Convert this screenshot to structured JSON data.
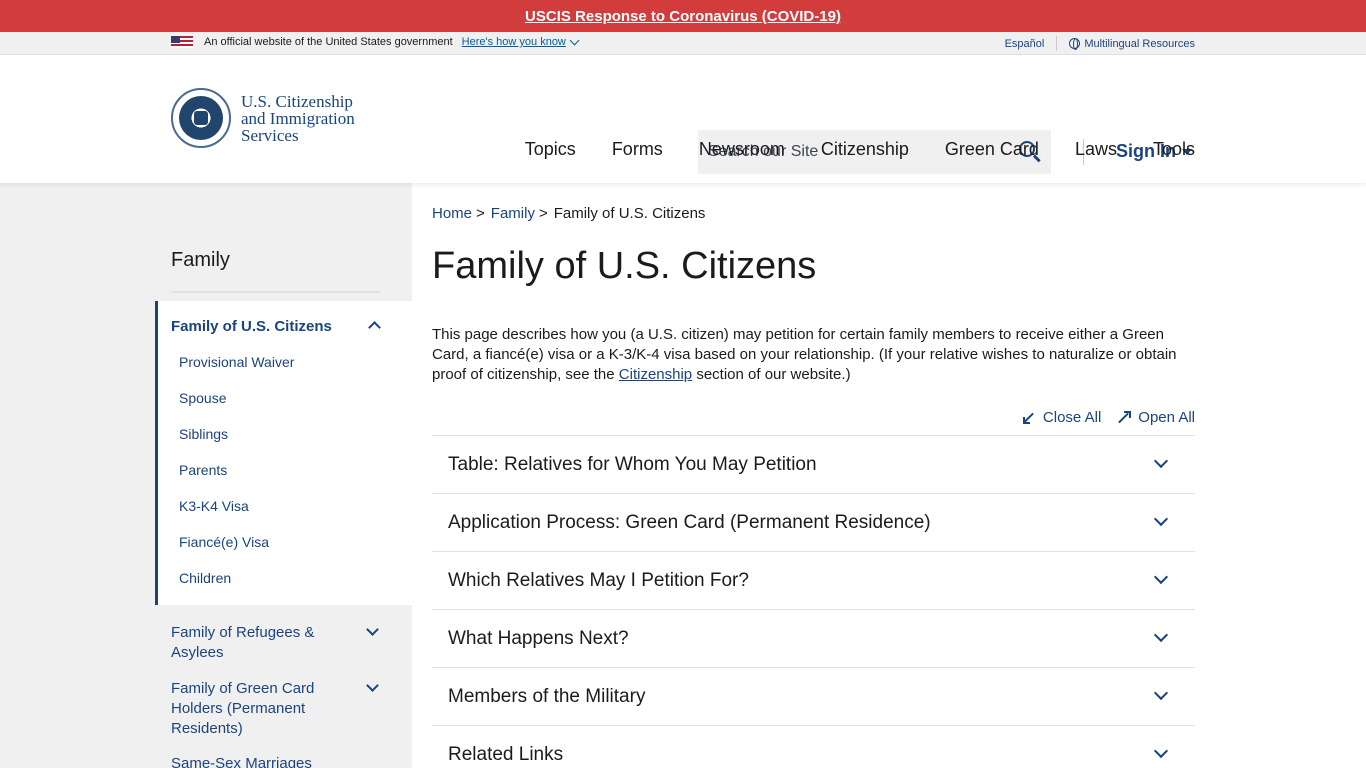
{
  "alert": {
    "text": "USCIS Response to Coronavirus (COVID-19)"
  },
  "gov_banner": {
    "official_text": "An official website of the United States government",
    "how_link": "Here's how you know",
    "espanol": "Español",
    "multilingual": "Multilingual Resources"
  },
  "header": {
    "logo_line1": "U.S. Citizenship",
    "logo_line2": "and Immigration",
    "logo_line3": "Services",
    "search_placeholder": "Search our Site",
    "sign_in": "Sign In",
    "nav": [
      "Topics",
      "Forms",
      "Newsroom",
      "Citizenship",
      "Green Card",
      "Laws",
      "Tools"
    ]
  },
  "sidebar": {
    "title": "Family",
    "active_section": "Family of U.S. Citizens",
    "sub_items": [
      "Provisional Waiver",
      "Spouse",
      "Siblings",
      "Parents",
      "K3-K4 Visa",
      "Fiancé(e) Visa",
      "Children"
    ],
    "other_items": [
      "Family of Refugees & Asylees",
      "Family of Green Card Holders (Permanent Residents)",
      "Same-Sex Marriages"
    ]
  },
  "breadcrumb": {
    "home": "Home",
    "family": "Family",
    "current": "Family of U.S. Citizens",
    "separator": ">"
  },
  "page": {
    "title": "Family of U.S. Citizens",
    "intro_before": "This page describes how you (a U.S. citizen) may petition for certain family members to receive either a Green Card, a fiancé(e) visa or a K-3/K-4 visa based on your relationship. (If your relative wishes to naturalize or obtain proof of citizenship, see the ",
    "intro_link": "Citizenship",
    "intro_after": " section of our website.)",
    "close_all": "Close All",
    "open_all": "Open All",
    "accordion": [
      "Table: Relatives for Whom You May Petition",
      "Application Process: Green Card (Permanent Residence)",
      "Which Relatives May I Petition For?",
      "What Happens Next?",
      "Members of the Military",
      "Related Links"
    ]
  },
  "colors": {
    "alert_red": "#d23c3c",
    "link_blue": "#1a4480",
    "sidebar_gray": "#f0f0f0"
  }
}
